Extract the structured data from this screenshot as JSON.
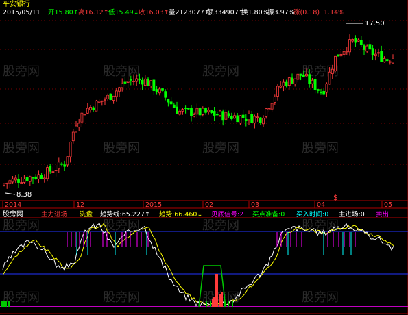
{
  "header": {
    "stock_name": "平安银行",
    "date": "2015/05/11",
    "items": [
      {
        "label": "开",
        "value": "15.80",
        "arrow": "↑",
        "color": "#00ff00"
      },
      {
        "label": "高",
        "value": "16.12",
        "arrow": "↑",
        "color": "#ff3b3b"
      },
      {
        "label": "低",
        "value": "15.49",
        "arrow": "↓",
        "color": "#00ff00"
      },
      {
        "label": "收",
        "value": "16.03",
        "arrow": "↑",
        "color": "#ff3b3b"
      },
      {
        "label": "量",
        "value": "2123077",
        "arrow": "↑",
        "color": "#ffffff"
      },
      {
        "label": "额",
        "value": "334907",
        "arrow": "↑",
        "color": "#ffffff"
      },
      {
        "label": "换",
        "value": "1.80%",
        "arrow": "",
        "color": "#ffffff"
      },
      {
        "label": "振",
        "value": "3.97%",
        "arrow": "",
        "color": "#ffffff"
      },
      {
        "label": "涨",
        "value": "(0.18)",
        "arrow": "",
        "color": "#ff3b3b"
      },
      {
        "label": "",
        "value": "1.14%",
        "arrow": "",
        "color": "#ff3b3b"
      }
    ]
  },
  "price_chart": {
    "high_marker": "17.50",
    "low_marker": "8.38",
    "signal_marker": "$",
    "ylim": [
      7.5,
      18.2
    ]
  },
  "time_axis": {
    "labels": [
      "2014",
      "12",
      "2015",
      "02",
      "03",
      "04",
      "05"
    ]
  },
  "indicator_panel": {
    "name": "股旁网",
    "legend": [
      {
        "text": "主力进场",
        "color": "#ff3b3b"
      },
      {
        "text": "洗盘",
        "color": "#ffff00"
      },
      {
        "text": "趋势线:65.227",
        "arrow": "↑",
        "color": "#ffffff"
      },
      {
        "text": "趋势:66.460",
        "arrow": "↓",
        "color": "#ffff00"
      },
      {
        "text": "见底信号:2",
        "color": "#ff00ff"
      },
      {
        "text": "买点准备:0",
        "color": "#00ff00"
      },
      {
        "text": "买入时间:0",
        "color": "#00ffff"
      },
      {
        "text": "主进场:0",
        "color": "#ffffff"
      },
      {
        "text": "卖出",
        "color": "#ff00ff"
      }
    ]
  },
  "watermark": "股旁网",
  "colors": {
    "up": "#ff3b3b",
    "down": "#00ff00",
    "frame": "#b00000",
    "grid": "#7a0000",
    "line_white": "#ffffff",
    "line_yellow": "#ffff00",
    "magenta": "#ff00ff",
    "blue": "#2233ff",
    "cyan": "#00ffff",
    "green": "#00c800"
  },
  "chart_data": {
    "type": "candlestick",
    "dates": [
      "2014-09",
      "2014-10",
      "2014-11",
      "2014-12",
      "2015-01",
      "2015-02",
      "2015-03",
      "2015-04",
      "2015-05"
    ],
    "close": [
      8.6,
      9.4,
      10.3,
      13.8,
      14.3,
      12.6,
      12.1,
      15.9,
      16.03
    ],
    "ylim": [
      7.5,
      18.2
    ],
    "indicator": {
      "trend_line_last": 65.227,
      "trend_last": 66.46,
      "ylim": [
        0,
        100
      ]
    }
  }
}
